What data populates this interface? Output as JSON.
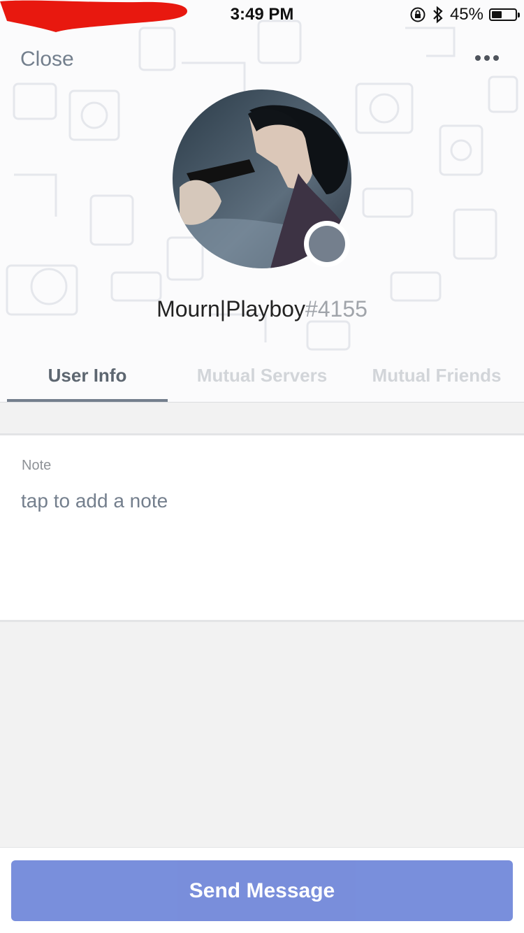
{
  "status_bar": {
    "time": "3:49 PM",
    "battery_percent_text": "45%",
    "battery_level": 0.45,
    "icons": [
      "orientation-lock-icon",
      "bluetooth-icon",
      "battery-icon"
    ]
  },
  "header": {
    "close_label": "Close",
    "more_icon": "more-horizontal-icon"
  },
  "profile": {
    "username": "Mourn|Playboy",
    "discriminator": "#4155",
    "status_color": "#747f8d"
  },
  "tabs": [
    {
      "label": "User Info",
      "active": true
    },
    {
      "label": "Mutual Servers",
      "active": false
    },
    {
      "label": "Mutual Friends",
      "active": false
    }
  ],
  "note": {
    "label": "Note",
    "placeholder": "tap to add a note"
  },
  "footer": {
    "send_message_label": "Send Message",
    "button_color": "#7289da"
  }
}
